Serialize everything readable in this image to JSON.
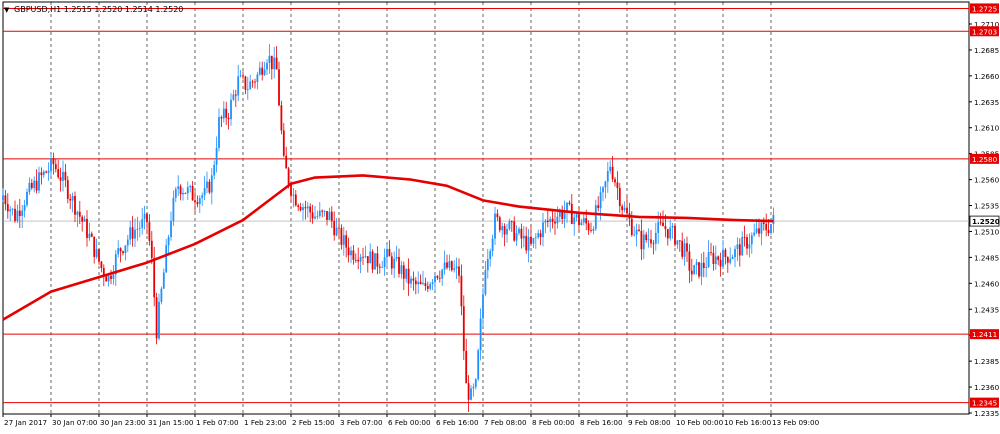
{
  "chart_header": {
    "dropdown_glyph": "▼",
    "text": "GBPUSD,H1  1.2515 1.2520 1.2514 1.2520"
  },
  "colors": {
    "background": "#ffffff",
    "bull": "#1e90ff",
    "bear": "#e60000",
    "ma": "#e60000",
    "level_line": "#e60000",
    "badge_bg": "#e60000",
    "badge_text": "#ffffff",
    "price_badge_bg": "#ffffff",
    "price_badge_text": "#000000",
    "grid": "#000000",
    "axis": "#000000",
    "text": "#000000"
  },
  "chart_data": {
    "type": "candlestick",
    "symbol": "GBPUSD",
    "timeframe": "H1",
    "grid": true,
    "ylim": [
      2.2331,
      1.2738
    ],
    "yticks": [
      1.2335,
      1.236,
      1.2385,
      1.241,
      1.2435,
      1.246,
      1.2485,
      1.251,
      1.2535,
      1.256,
      1.2585,
      1.261,
      1.2635,
      1.266,
      1.2685,
      1.271
    ],
    "horizontal_levels": [
      1.2725,
      1.2703,
      1.258,
      1.2411,
      1.2345
    ],
    "current_price": 1.252,
    "x_labels": [
      "27 Jan 2017",
      "30 Jan 07:00",
      "30 Jan 23:00",
      "31 Jan 15:00",
      "1 Feb 07:00",
      "1 Feb 23:00",
      "2 Feb 15:00",
      "3 Feb 07:00",
      "6 Feb 00:00",
      "6 Feb 16:00",
      "7 Feb 08:00",
      "8 Feb 00:00",
      "8 Feb 16:00",
      "9 Feb 08:00",
      "10 Feb 00:00",
      "10 Feb 16:00",
      "13 Feb 09:00"
    ],
    "close_path": [
      [
        0,
        1.2545
      ],
      [
        5,
        1.2525
      ],
      [
        10,
        1.2545
      ],
      [
        15,
        1.256
      ],
      [
        21,
        1.2575
      ],
      [
        26,
        1.2555
      ],
      [
        31,
        1.253
      ],
      [
        36,
        1.2505
      ],
      [
        41,
        1.2475
      ],
      [
        44,
        1.2465
      ],
      [
        48,
        1.249
      ],
      [
        54,
        1.251
      ],
      [
        60,
        1.252
      ],
      [
        62,
        1.248
      ],
      [
        64,
        1.2415
      ],
      [
        67,
        1.247
      ],
      [
        70,
        1.2525
      ],
      [
        73,
        1.2555
      ],
      [
        76,
        1.255
      ],
      [
        79,
        1.2545
      ],
      [
        84,
        1.2545
      ],
      [
        87,
        1.256
      ],
      [
        90,
        1.2615
      ],
      [
        94,
        1.2625
      ],
      [
        98,
        1.2655
      ],
      [
        102,
        1.265
      ],
      [
        106,
        1.266
      ],
      [
        110,
        1.268
      ],
      [
        114,
        1.2665
      ],
      [
        117,
        1.2575
      ],
      [
        121,
        1.2545
      ],
      [
        125,
        1.2535
      ],
      [
        130,
        1.2525
      ],
      [
        136,
        1.2525
      ],
      [
        140,
        1.2505
      ],
      [
        145,
        1.249
      ],
      [
        150,
        1.249
      ],
      [
        155,
        1.248
      ],
      [
        160,
        1.2485
      ],
      [
        165,
        1.2475
      ],
      [
        170,
        1.246
      ],
      [
        175,
        1.2455
      ],
      [
        180,
        1.247
      ],
      [
        185,
        1.2475
      ],
      [
        190,
        1.247
      ],
      [
        193,
        1.236
      ],
      [
        195,
        1.235
      ],
      [
        197,
        1.236
      ],
      [
        199,
        1.242
      ],
      [
        201,
        1.248
      ],
      [
        205,
        1.252
      ],
      [
        210,
        1.2515
      ],
      [
        215,
        1.2505
      ],
      [
        220,
        1.2495
      ],
      [
        225,
        1.2515
      ],
      [
        230,
        1.2525
      ],
      [
        235,
        1.253
      ],
      [
        240,
        1.252
      ],
      [
        245,
        1.2515
      ],
      [
        250,
        1.2545
      ],
      [
        253,
        1.2575
      ],
      [
        255,
        1.256
      ],
      [
        258,
        1.2535
      ],
      [
        262,
        1.2515
      ],
      [
        266,
        1.25
      ],
      [
        270,
        1.2505
      ],
      [
        275,
        1.2515
      ],
      [
        280,
        1.2505
      ],
      [
        284,
        1.249
      ],
      [
        287,
        1.247
      ],
      [
        291,
        1.2475
      ],
      [
        295,
        1.2485
      ],
      [
        300,
        1.2485
      ],
      [
        305,
        1.249
      ],
      [
        310,
        1.25
      ],
      [
        315,
        1.251
      ],
      [
        319,
        1.2515
      ],
      [
        321,
        1.252
      ]
    ],
    "ma_path": [
      [
        0,
        1.2425
      ],
      [
        20,
        1.2452
      ],
      [
        40,
        1.2466
      ],
      [
        60,
        1.248
      ],
      [
        80,
        1.2498
      ],
      [
        100,
        1.2521
      ],
      [
        112,
        1.2542
      ],
      [
        120,
        1.2556
      ],
      [
        130,
        1.2562
      ],
      [
        150,
        1.2564
      ],
      [
        170,
        1.256
      ],
      [
        185,
        1.2554
      ],
      [
        200,
        1.254
      ],
      [
        215,
        1.2534
      ],
      [
        240,
        1.2528
      ],
      [
        265,
        1.2524
      ],
      [
        285,
        1.2523
      ],
      [
        305,
        1.2521
      ],
      [
        321,
        1.252
      ]
    ]
  }
}
